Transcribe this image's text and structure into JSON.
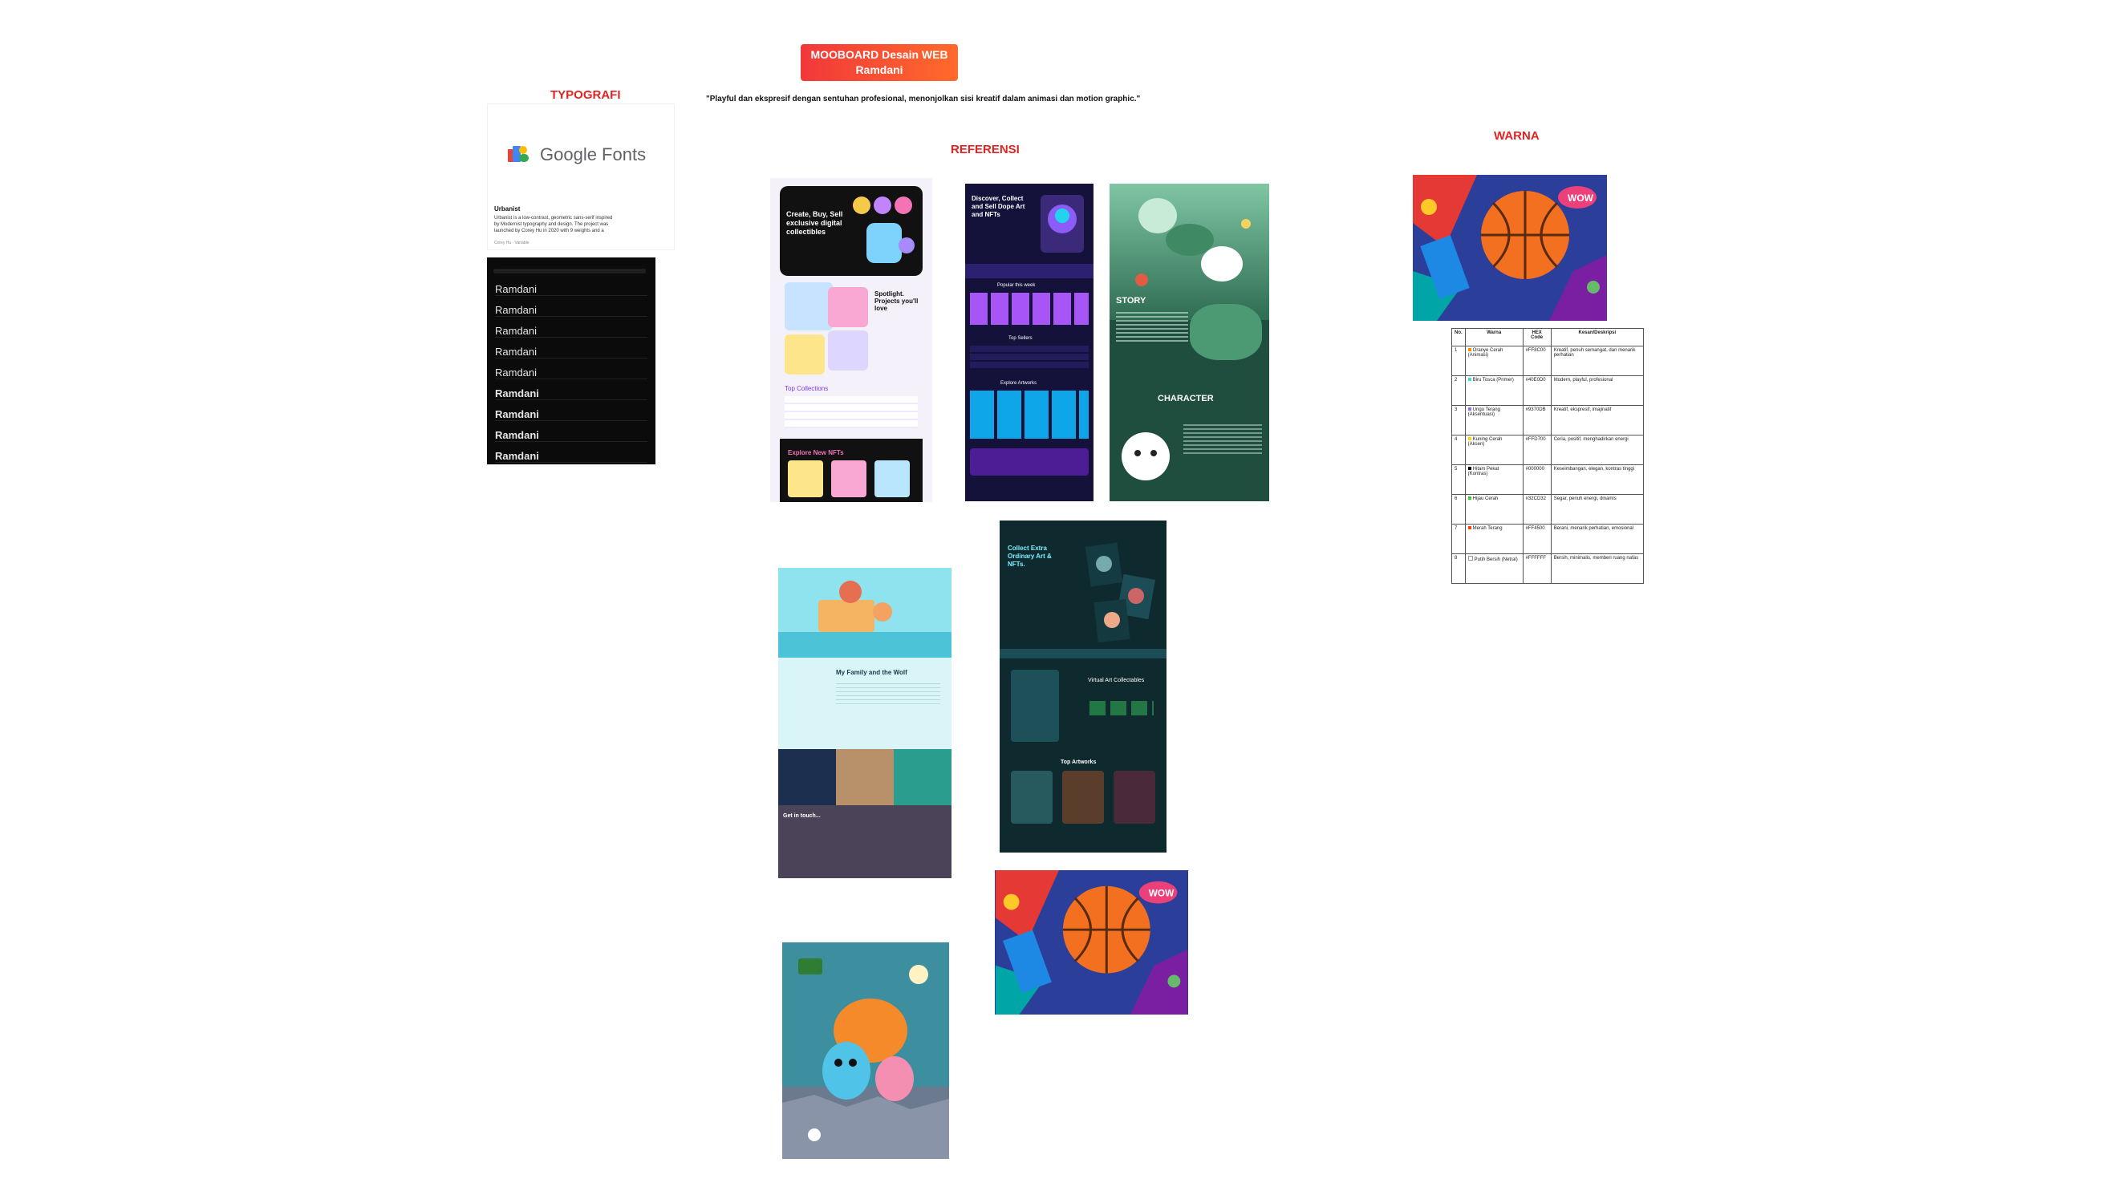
{
  "title": "MOOBOARD Desain WEB Ramdani",
  "tagline": "\"Playful dan ekspresif dengan sentuhan profesional, menonjolkan sisi kreatif dalam animasi dan motion graphic.\"",
  "sections": {
    "typografi": "TYPOGRAFI",
    "referensi": "REFERENSI",
    "warna": "WARNA"
  },
  "typography": {
    "brand": "Google Fonts",
    "font_name": "Urbanist",
    "font_desc": "Urbanist is a low-contrast, geometric sans-serif inspired by Modernist typography and design. The project was launched by Corey Hu in 2020 with 9 weights and a",
    "font_meta": "Corey Hu  ·  Variable",
    "sample_text": "Ramdani",
    "samples": [
      "Ramdani",
      "Ramdani",
      "Ramdani",
      "Ramdani",
      "Ramdani",
      "Ramdani",
      "Ramdani",
      "Ramdani",
      "Ramdani"
    ]
  },
  "references": {
    "nft_market": {
      "headline": "Create, Buy, Sell exclusive digital collectibles",
      "spotlight": "Spotlight. Projects you'll love",
      "top": "Top Collections",
      "explore": "Explore New NFTs"
    },
    "nft_dark": {
      "headline": "Discover, Collect and Sell Dope Art and NFTs",
      "popular": "Popular this week",
      "sellers": "Top Sellers",
      "explore": "Explore Artworks"
    },
    "ghost_game": {
      "story": "STORY",
      "character": "CHARACTER"
    },
    "family_wolf": {
      "headline": "My Family and the Wolf",
      "sub": "Get in touch..."
    },
    "collect_art": {
      "headline": "Collect Extra Ordinary Art & NFTs.",
      "auction": "Virtual Art Collectables",
      "top": "Top Artworks"
    }
  },
  "colors": {
    "header": [
      "No.",
      "Warna",
      "HEX Code",
      "Kesan/Deskripsi"
    ],
    "rows": [
      {
        "no": "1",
        "name": "Oranye Cerah (Animasi)",
        "hex": "#FF8C00",
        "desc": "Kreatif, penuh semangat, dan menarik perhatian",
        "swatch": "#FF8C00"
      },
      {
        "no": "2",
        "name": "Biru Tosca (Primer)",
        "hex": "#40E0D0",
        "desc": "Modern, playful, profesional",
        "swatch": "#40E0D0"
      },
      {
        "no": "3",
        "name": "Ungu Terang (Aksentuasi)",
        "hex": "#9370DB",
        "desc": "Kreatif, ekspresif, imajinatif",
        "swatch": "#9370DB"
      },
      {
        "no": "4",
        "name": "Kuning Cerah (Aksen)",
        "hex": "#FFD700",
        "desc": "Ceria, positif, menghadirkan energi",
        "swatch": "#FFD700"
      },
      {
        "no": "5",
        "name": "Hitam Pekat (Kontras)",
        "hex": "#000000",
        "desc": "Keseimbangan, elegan, kontras tinggi",
        "swatch": "#000000"
      },
      {
        "no": "6",
        "name": "Hijau Cerah",
        "hex": "#32CD32",
        "desc": "Segar, penuh energi, dinamis",
        "swatch": "#32CD32"
      },
      {
        "no": "7",
        "name": "Merah Terang",
        "hex": "#FF4500",
        "desc": "Berani, menarik perhatian, emosional",
        "swatch": "#FF4500"
      },
      {
        "no": "8",
        "name": "Putih Bersih (Netral)",
        "hex": "#FFFFFF",
        "desc": "Bersih, minimalis, memberi ruang nafas",
        "swatch": "#FFFFFF"
      }
    ]
  },
  "palette": {
    "accent": "#e02424",
    "badge_from": "#f2383a",
    "badge_to": "#ff6a2b"
  }
}
